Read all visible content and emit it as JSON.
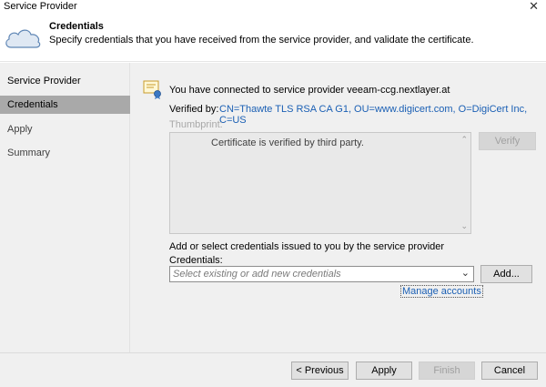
{
  "window": {
    "title": "Service Provider",
    "close_glyph": "✕"
  },
  "header": {
    "title": "Credentials",
    "description": "Specify credentials that you have received from the service provider, and validate the certificate.",
    "icon": "cloud-icon"
  },
  "sidebar": {
    "items": [
      {
        "label": "Service Provider",
        "active": false
      },
      {
        "label": "Credentials",
        "active": true
      },
      {
        "label": "Apply",
        "active": false
      },
      {
        "label": "Summary",
        "active": false
      }
    ]
  },
  "certificate": {
    "icon": "certificate-icon",
    "connected_text": "You have connected to service provider veeam-ccg.nextlayer.at",
    "verified_label": "Verified by:",
    "verified_value": "CN=Thawte TLS RSA CA G1, OU=www.digicert.com, O=DigiCert Inc, C=US",
    "thumbprint_label": "Thumbprint:",
    "thumbprint_text": "Certificate is verified by third party.",
    "verify_button": "Verify"
  },
  "credentials": {
    "prompt": "Add or select credentials issued to you by the service provider",
    "label": "Credentials:",
    "placeholder": "Select existing or add new credentials",
    "add_button": "Add...",
    "manage_link": "Manage accounts"
  },
  "footer": {
    "previous": "< Previous",
    "apply": "Apply",
    "finish": "Finish",
    "cancel": "Cancel"
  },
  "colors": {
    "link": "#1a5fb4",
    "active_nav": "#a9a9a9",
    "panel": "#f0f0f0"
  }
}
